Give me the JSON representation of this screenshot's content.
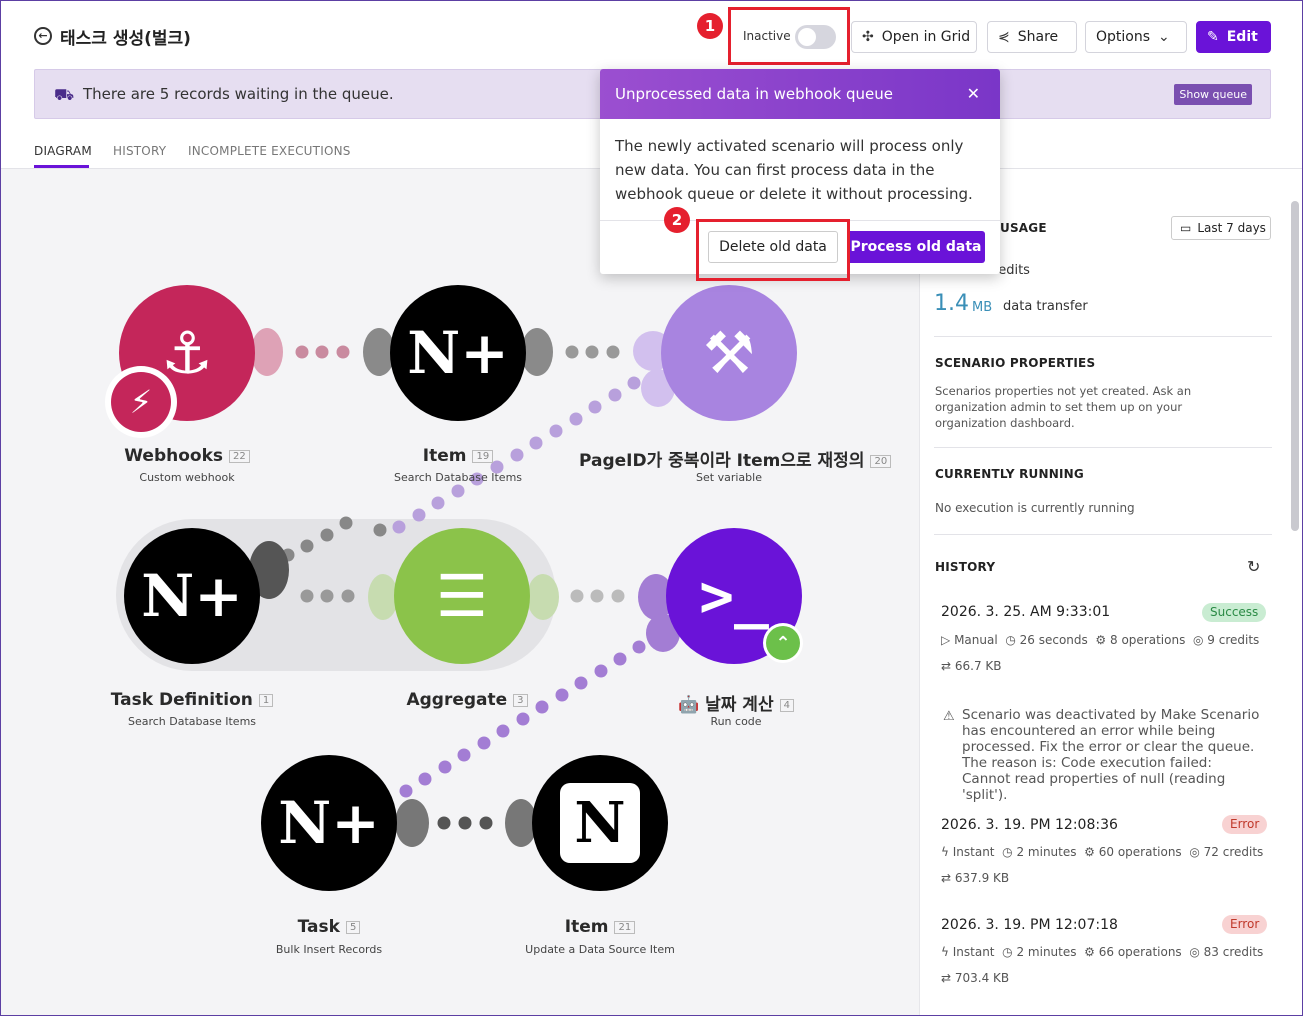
{
  "header": {
    "title": "태스크 생성(벌크)",
    "toggle_label": "Inactive",
    "open_grid": "Open in Grid",
    "share": "Share",
    "options": "Options",
    "edit": "Edit"
  },
  "callouts": [
    "1",
    "2"
  ],
  "banner": {
    "text": "There are 5 records waiting in the queue.",
    "show_queue": "Show queue"
  },
  "tabs": [
    "DIAGRAM",
    "HISTORY",
    "INCOMPLETE EXECUTIONS"
  ],
  "popup": {
    "title": "Unprocessed data in webhook queue",
    "body": "The newly activated scenario will process only new data. You can first process data in the webhook queue or delete it without processing.",
    "delete_label": "Delete old data",
    "process_label": "Process old data"
  },
  "nodes": [
    {
      "name": "Webhooks",
      "num": "22",
      "sub": "Custom webhook"
    },
    {
      "name": "Item",
      "num": "19",
      "sub": "Search Database Items"
    },
    {
      "name": "PageID가 중복이라 Item으로 재정의",
      "num": "20",
      "sub": "Set variable"
    },
    {
      "name": "Task Definition",
      "num": "1",
      "sub": "Search Database Items"
    },
    {
      "name": "Aggregate",
      "num": "3",
      "sub": ""
    },
    {
      "name": "🤖 날짜 계산",
      "num": "4",
      "sub": "Run code"
    },
    {
      "name": "Task",
      "num": "5",
      "sub": "Bulk Insert Records"
    },
    {
      "name": "Item",
      "num": "21",
      "sub": "Update a Data Source Item"
    }
  ],
  "sidebar": {
    "usage_heading": "USAGE",
    "last7": "Last 7 days",
    "credits_label": "credits",
    "transfer_value": "1.4",
    "transfer_unit": "MB",
    "transfer_label": "data transfer",
    "props_heading": "SCENARIO PROPERTIES",
    "props_text": "Scenarios properties not yet created. Ask an organization admin to set them up on your organization dashboard.",
    "running_heading": "CURRENTLY RUNNING",
    "running_text": "No execution is currently running",
    "history_heading": "HISTORY",
    "history": [
      {
        "date": "2026. 3. 25. AM 9:33:01",
        "status": "Success",
        "mode": "Manual",
        "duration": "26 seconds",
        "operations": "8 operations",
        "credits": "9 credits",
        "size": "66.7 KB"
      },
      {
        "date": "2026. 3. 19. PM 12:08:36",
        "status": "Error",
        "mode": "Instant",
        "duration": "2 minutes",
        "operations": "60 operations",
        "credits": "72 credits",
        "size": "637.9 KB"
      },
      {
        "date": "2026. 3. 19. PM 12:07:18",
        "status": "Error",
        "mode": "Instant",
        "duration": "2 minutes",
        "operations": "66 operations",
        "credits": "83 credits",
        "size": "703.4 KB"
      }
    ],
    "warning": "Scenario was deactivated by Make Scenario has encountered an error while being processed. Fix the error or clear the queue. The reason is: Code execution failed: Cannot read properties of null (reading 'split')."
  },
  "colors": {
    "accent": "#6a13d8",
    "webhook": "#c4265a",
    "notion": "#000000",
    "tools": "#a884e0",
    "aggregate": "#8bc34a",
    "code": "#6a13d8",
    "callout": "#e5202e"
  }
}
